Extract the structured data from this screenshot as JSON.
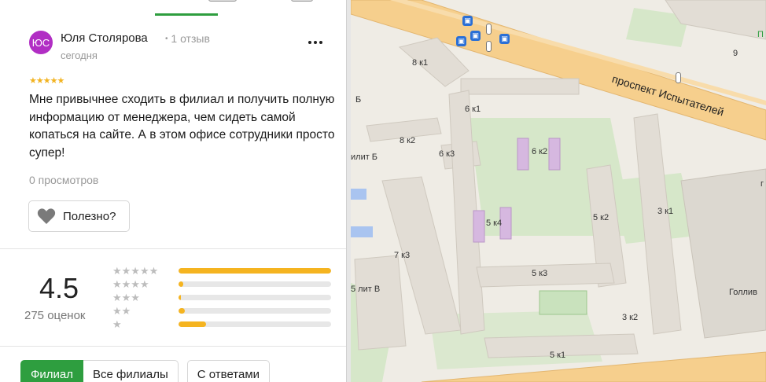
{
  "review": {
    "avatar_initials": "ЮС",
    "avatar_color": "#b12ec4",
    "author": "Юля Столярова",
    "separator": "•",
    "reviews_count": "1 отзыв",
    "date": "сегодня",
    "stars": "★★★★★",
    "text": "Мне привычнее сходить в филиал и получить полную информацию от менеджера, чем сидеть самой копаться на сайте. А в этом офисе сотрудники просто супер!",
    "views": "0 просмотров",
    "helpful_label": "Полезно?",
    "more_icon": "more-dots-icon",
    "helpful_icon": "heart-icon"
  },
  "rating": {
    "value": "4.5",
    "count": "275 оценок",
    "distribution": [
      {
        "stars": "★★★★★",
        "fraction": 1.0
      },
      {
        "stars": "★★★★",
        "fraction": 0.03
      },
      {
        "stars": "★★★",
        "fraction": 0.015
      },
      {
        "stars": "★★",
        "fraction": 0.04
      },
      {
        "stars": "★",
        "fraction": 0.18
      }
    ],
    "bar_color": "#f5b420"
  },
  "filters": {
    "branch": "Филиал",
    "all_branches": "Все филиалы",
    "with_replies": "С ответами"
  },
  "map": {
    "street": "проспект Испытателей",
    "labels": [
      "8 к1",
      "6 к1",
      "8 к2",
      "6 к3",
      "6 к2",
      "5 к4",
      "5 к2",
      "3 к1",
      "7 к3",
      "5 к3",
      "5 лит В",
      "3 к2",
      "5 к1",
      "илит Б",
      "Б",
      "9",
      "П",
      "Голлив",
      "г"
    ]
  }
}
